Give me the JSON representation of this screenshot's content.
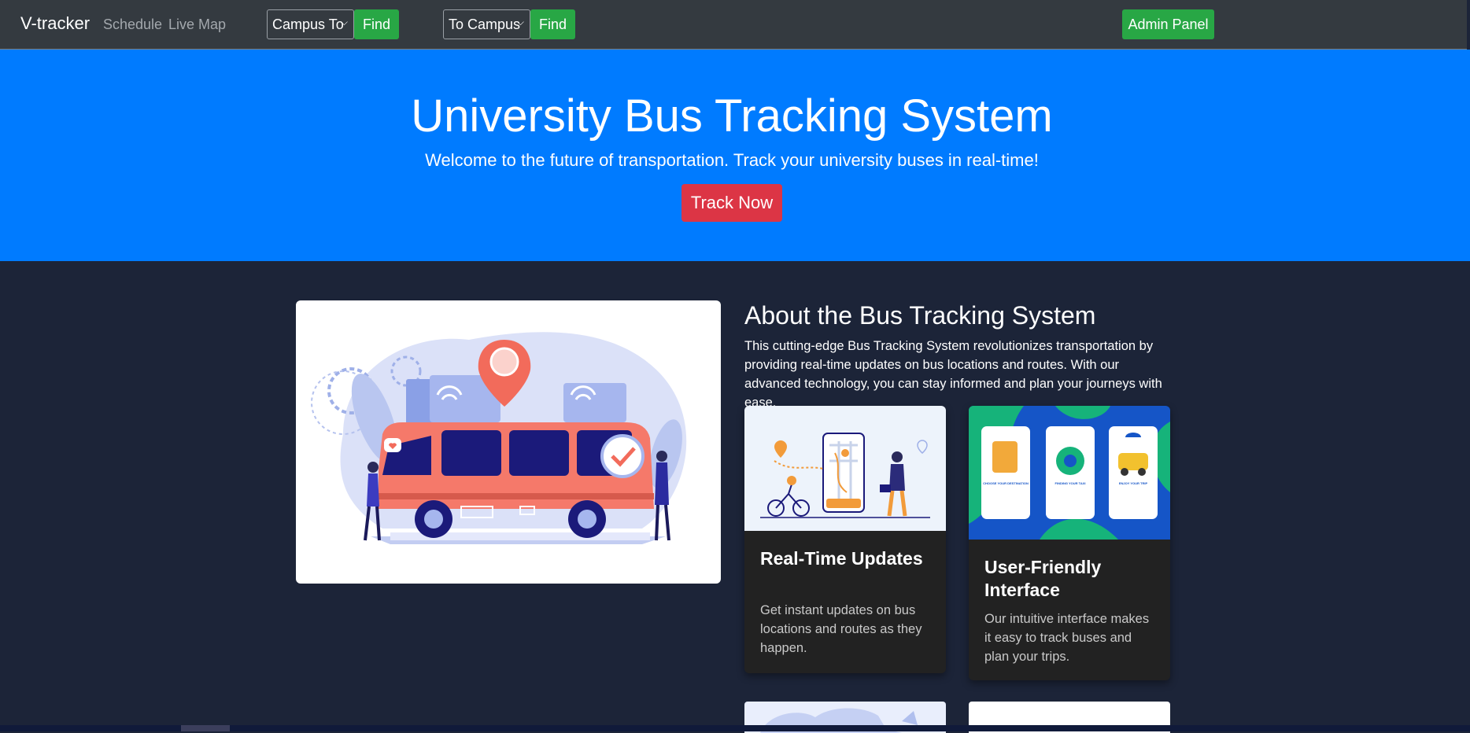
{
  "nav": {
    "brand": "V-tracker",
    "links": [
      "Schedule",
      "Live Map"
    ],
    "select_1": "Campus To",
    "find_1": "Find",
    "select_2": "To Campus",
    "find_2": "Find",
    "admin": "Admin Panel"
  },
  "hero": {
    "title": "University Bus Tracking System",
    "subtitle": "Welcome to the future of transportation. Track your university buses in real-time!",
    "button": "Track Now"
  },
  "about": {
    "title": "About the Bus Tracking System",
    "description": "This cutting-edge Bus Tracking System revolutionizes transportation by providing real-time updates on bus locations and routes. With our advanced technology, you can stay informed and plan your journeys with ease."
  },
  "features": [
    {
      "title": "Real-Time Updates",
      "text": "Get instant updates on bus locations and routes as they happen."
    },
    {
      "title": "User-Friendly Interface",
      "text": "Our intuitive interface makes it easy to track buses and plan your trips."
    }
  ],
  "phone_screens": [
    "CHOOSE YOUR DESTINATION",
    "FINDING YOUR TAXI",
    "ENJOY YOUR TRIP"
  ],
  "colors": {
    "navbar": "#343a40",
    "hero": "#007bff",
    "page_bg": "#1c2438",
    "success": "#28a745",
    "danger": "#dc3545",
    "card_bg": "#222222"
  }
}
